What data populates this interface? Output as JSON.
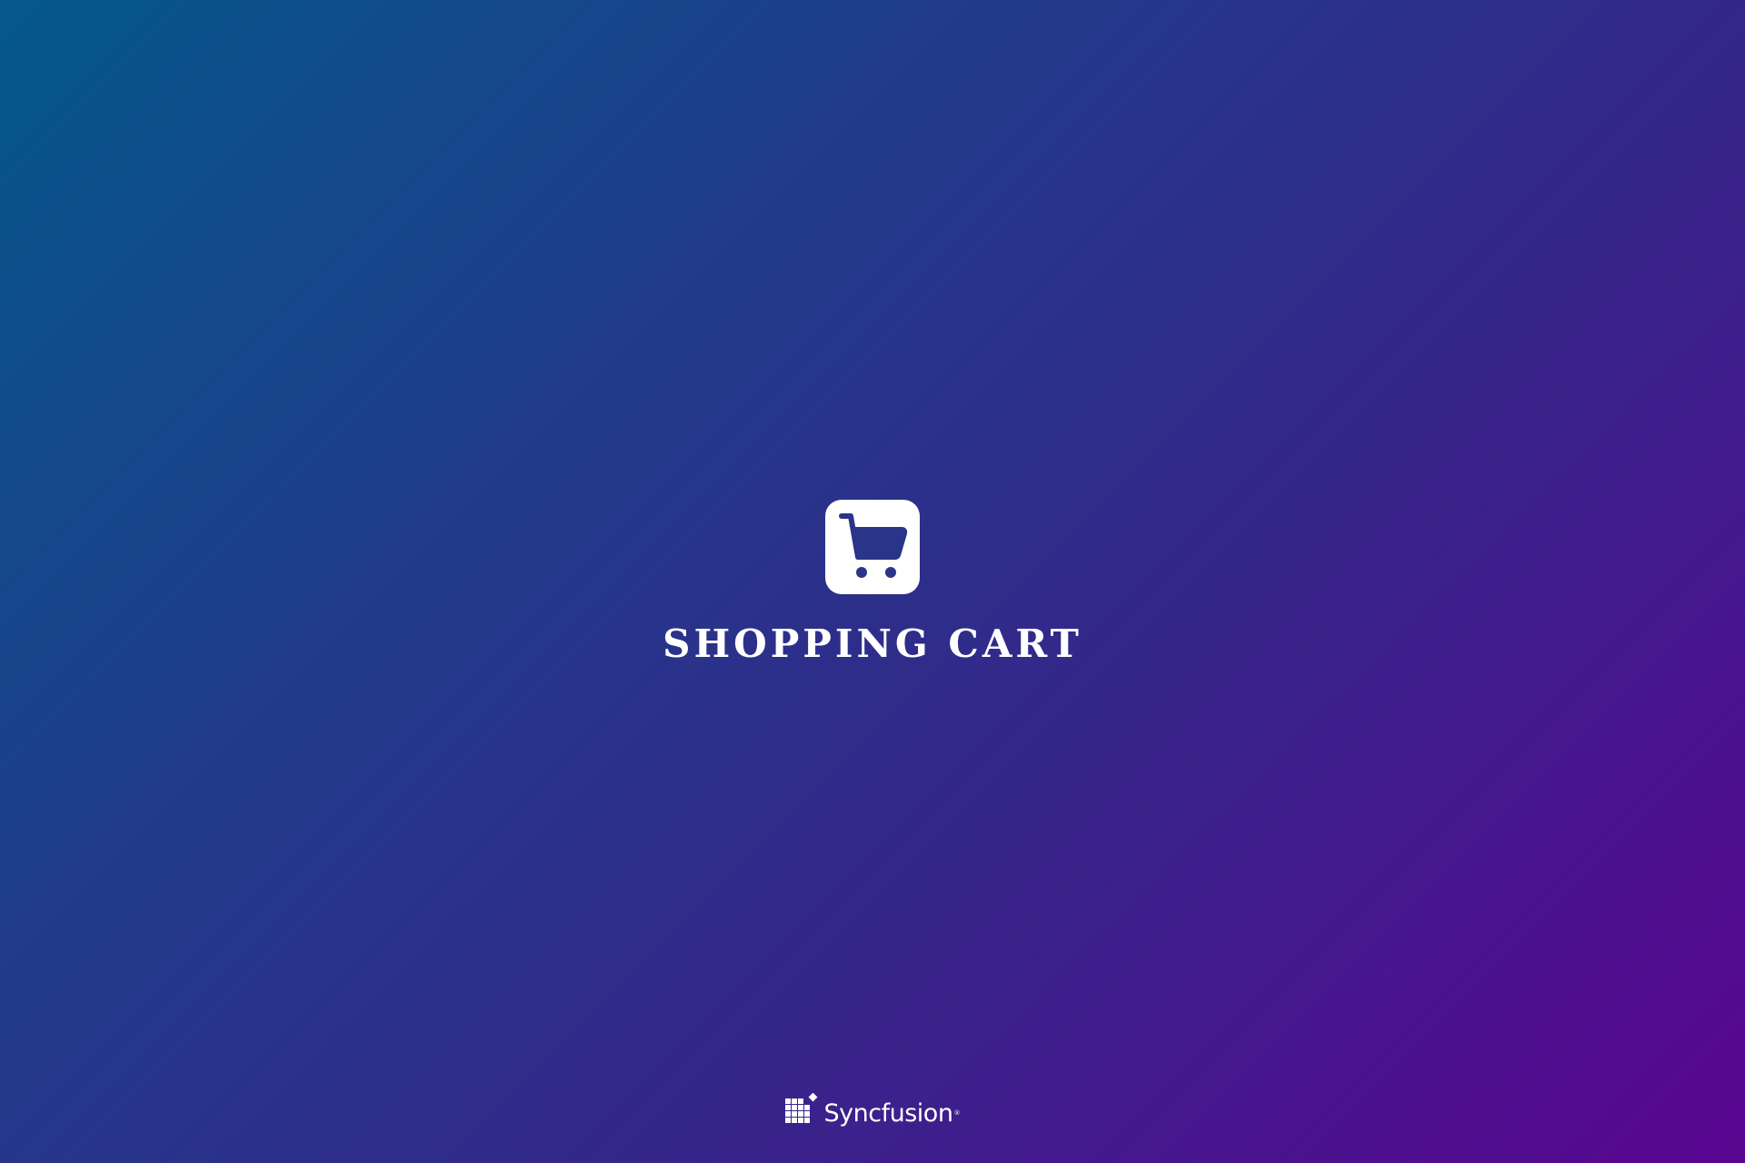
{
  "splash": {
    "icon": "shopping-cart-icon",
    "title": "SHOPPING CART"
  },
  "footer": {
    "logo_icon": "syncfusion-logo-mark",
    "brand_name": "Syncfusion",
    "registered_mark": "®"
  },
  "colors": {
    "gradient_start": "#04588c",
    "gradient_end": "#5a0591",
    "icon_tile": "#ffffff",
    "icon_glyph": "#2a3488",
    "text": "#ffffff"
  }
}
